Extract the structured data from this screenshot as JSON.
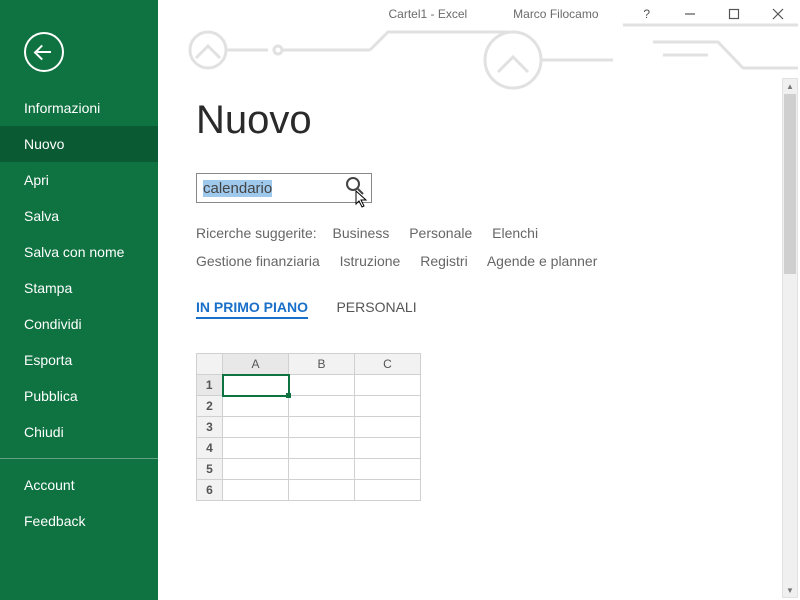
{
  "window": {
    "title_left": "Cartel1  -  Excel",
    "title_right": "Marco Filocamo",
    "help": "?"
  },
  "sidebar": {
    "items": [
      "Informazioni",
      "Nuovo",
      "Apri",
      "Salva",
      "Salva con nome",
      "Stampa",
      "Condividi",
      "Esporta",
      "Pubblica",
      "Chiudi"
    ],
    "footer": [
      "Account",
      "Feedback"
    ]
  },
  "page": {
    "title": "Nuovo",
    "search_value": "calendario",
    "suggestions_label": "Ricerche suggerite:",
    "suggestions": [
      "Business",
      "Personale",
      "Elenchi",
      "Gestione finanziaria",
      "Istruzione",
      "Registri",
      "Agende e planner"
    ],
    "tabs": {
      "featured": "IN PRIMO PIANO",
      "personal": "PERSONALI"
    }
  },
  "preview": {
    "cols": [
      "A",
      "B",
      "C"
    ],
    "rows": [
      "1",
      "2",
      "3",
      "4",
      "5",
      "6"
    ]
  }
}
